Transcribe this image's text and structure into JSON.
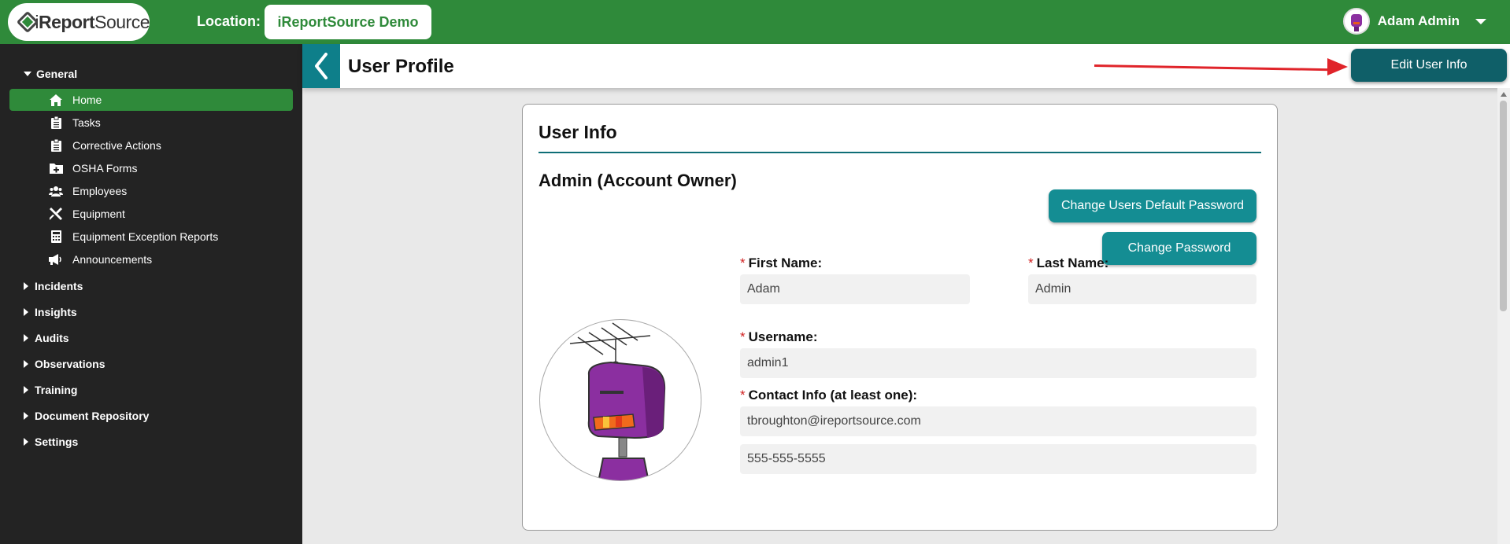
{
  "brand": {
    "logo_prefix": "i",
    "logo_bold": "Report",
    "logo_rest": "Source"
  },
  "location": {
    "label": "Location:",
    "value": "iReportSource Demo"
  },
  "user": {
    "name": "Adam Admin"
  },
  "sidebar": {
    "general_label": "General",
    "items": [
      {
        "label": "Home",
        "icon": "home-icon",
        "active": true
      },
      {
        "label": "Tasks",
        "icon": "clipboard-icon"
      },
      {
        "label": "Corrective Actions",
        "icon": "clipboard-icon"
      },
      {
        "label": "OSHA Forms",
        "icon": "folder-plus-icon"
      },
      {
        "label": "Employees",
        "icon": "users-icon"
      },
      {
        "label": "Equipment",
        "icon": "tools-icon"
      },
      {
        "label": "Equipment Exception Reports",
        "icon": "calculator-icon"
      },
      {
        "label": "Announcements",
        "icon": "megaphone-icon"
      }
    ],
    "sections": [
      "Incidents",
      "Insights",
      "Audits",
      "Observations",
      "Training",
      "Document Repository",
      "Settings"
    ]
  },
  "header": {
    "title": "User Profile",
    "edit_button": "Edit User Info"
  },
  "card": {
    "title": "User Info",
    "user_heading": "Admin (Account Owner)",
    "change_default_pw": "Change Users Default Password",
    "change_pw": "Change Password",
    "required_mark": "*",
    "first_name_label": "First Name:",
    "first_name_value": "Adam",
    "last_name_label": "Last Name:",
    "last_name_value": "Admin",
    "username_label": "Username:",
    "username_value": "admin1",
    "contact_label": "Contact Info (at least one):",
    "email_value": "tbroughton@ireportsource.com",
    "phone_value": "555-555-5555"
  },
  "colors": {
    "topbar": "#2f8a3a",
    "teal": "#148d93",
    "dark_teal": "#0f5f68",
    "sidebar": "#232323",
    "annotation_arrow": "#e0242a"
  }
}
